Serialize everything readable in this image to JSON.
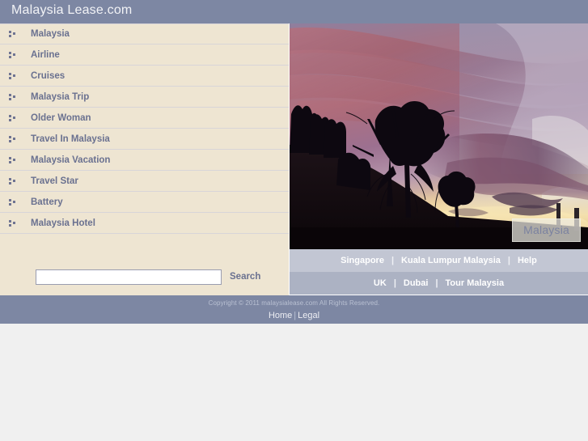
{
  "header": {
    "title": "Malaysia Lease.com",
    "bg_color": "#7d87a3"
  },
  "sidebar": {
    "bg_color": "#eee5d2",
    "bullet_icon": "bullet-squares-icon",
    "items": [
      {
        "label": "Malaysia"
      },
      {
        "label": "Airline"
      },
      {
        "label": "Cruises"
      },
      {
        "label": "Malaysia Trip"
      },
      {
        "label": "Older Woman"
      },
      {
        "label": "Travel In Malaysia"
      },
      {
        "label": "Malaysia Vacation"
      },
      {
        "label": "Travel Star"
      },
      {
        "label": "Battery"
      },
      {
        "label": "Malaysia Hotel"
      }
    ]
  },
  "search": {
    "value": "",
    "placeholder": "",
    "button_label": "Search"
  },
  "photo": {
    "alt": "sunset-sky-with-tree-silhouettes",
    "caption": "Malaysia"
  },
  "link_bars": [
    {
      "bg_color": "#c2c6d3",
      "links": [
        "Singapore",
        "Kuala Lumpur Malaysia",
        "Help"
      ],
      "separator": "|"
    },
    {
      "bg_color": "#acb2c3",
      "links": [
        "UK",
        "Dubai",
        "Tour Malaysia"
      ],
      "separator": "|"
    }
  ],
  "footer": {
    "bg_color": "#7d87a3",
    "copyright": "Copyright © 2011 malaysialease.com All Rights Reserved.",
    "links": [
      "Home",
      "Legal"
    ],
    "separator": "|"
  }
}
